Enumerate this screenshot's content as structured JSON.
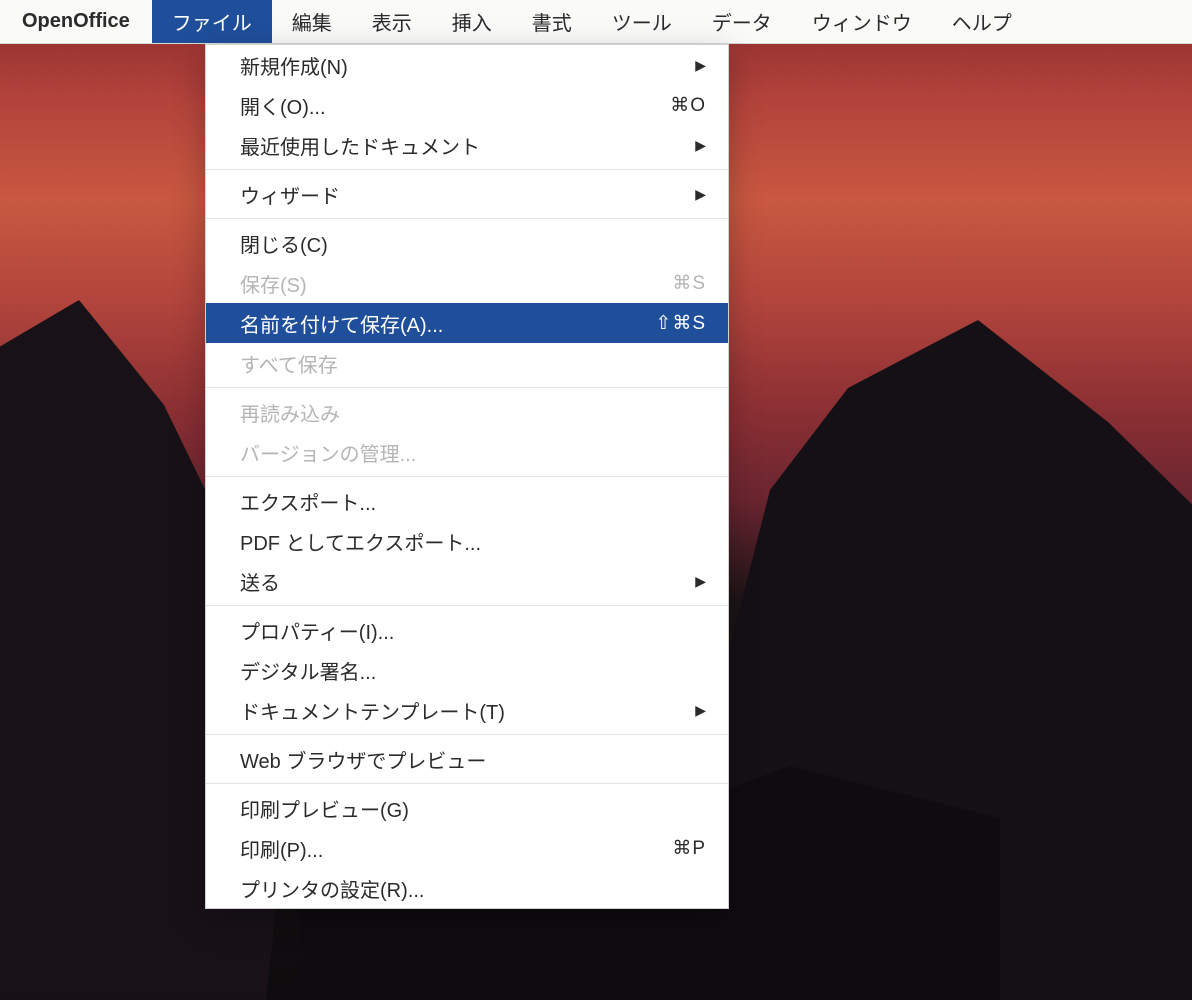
{
  "menubar": {
    "app": "OpenOffice",
    "items": [
      "ファイル",
      "編集",
      "表示",
      "挿入",
      "書式",
      "ツール",
      "データ",
      "ウィンドウ",
      "ヘルプ"
    ],
    "active_index": 0
  },
  "dropdown": {
    "groups": [
      [
        {
          "label": "新規作成(N)",
          "shortcut": "",
          "submenu": true,
          "disabled": false,
          "highlight": false
        },
        {
          "label": "開く(O)...",
          "shortcut": "⌘O",
          "submenu": false,
          "disabled": false,
          "highlight": false
        },
        {
          "label": "最近使用したドキュメント",
          "shortcut": "",
          "submenu": true,
          "disabled": false,
          "highlight": false
        }
      ],
      [
        {
          "label": "ウィザード",
          "shortcut": "",
          "submenu": true,
          "disabled": false,
          "highlight": false
        }
      ],
      [
        {
          "label": "閉じる(C)",
          "shortcut": "",
          "submenu": false,
          "disabled": false,
          "highlight": false
        },
        {
          "label": "保存(S)",
          "shortcut": "⌘S",
          "submenu": false,
          "disabled": true,
          "highlight": false
        },
        {
          "label": "名前を付けて保存(A)...",
          "shortcut": "⇧⌘S",
          "submenu": false,
          "disabled": false,
          "highlight": true
        },
        {
          "label": "すべて保存",
          "shortcut": "",
          "submenu": false,
          "disabled": true,
          "highlight": false
        }
      ],
      [
        {
          "label": "再読み込み",
          "shortcut": "",
          "submenu": false,
          "disabled": true,
          "highlight": false
        },
        {
          "label": "バージョンの管理...",
          "shortcut": "",
          "submenu": false,
          "disabled": true,
          "highlight": false
        }
      ],
      [
        {
          "label": "エクスポート...",
          "shortcut": "",
          "submenu": false,
          "disabled": false,
          "highlight": false
        },
        {
          "label": "PDF としてエクスポート...",
          "shortcut": "",
          "submenu": false,
          "disabled": false,
          "highlight": false
        },
        {
          "label": "送る",
          "shortcut": "",
          "submenu": true,
          "disabled": false,
          "highlight": false
        }
      ],
      [
        {
          "label": "プロパティー(I)...",
          "shortcut": "",
          "submenu": false,
          "disabled": false,
          "highlight": false
        },
        {
          "label": "デジタル署名...",
          "shortcut": "",
          "submenu": false,
          "disabled": false,
          "highlight": false
        },
        {
          "label": "ドキュメントテンプレート(T)",
          "shortcut": "",
          "submenu": true,
          "disabled": false,
          "highlight": false
        }
      ],
      [
        {
          "label": "Web ブラウザでプレビュー",
          "shortcut": "",
          "submenu": false,
          "disabled": false,
          "highlight": false
        }
      ],
      [
        {
          "label": "印刷プレビュー(G)",
          "shortcut": "",
          "submenu": false,
          "disabled": false,
          "highlight": false
        },
        {
          "label": "印刷(P)...",
          "shortcut": "⌘P",
          "submenu": false,
          "disabled": false,
          "highlight": false
        },
        {
          "label": "プリンタの設定(R)...",
          "shortcut": "",
          "submenu": false,
          "disabled": false,
          "highlight": false
        }
      ]
    ]
  }
}
